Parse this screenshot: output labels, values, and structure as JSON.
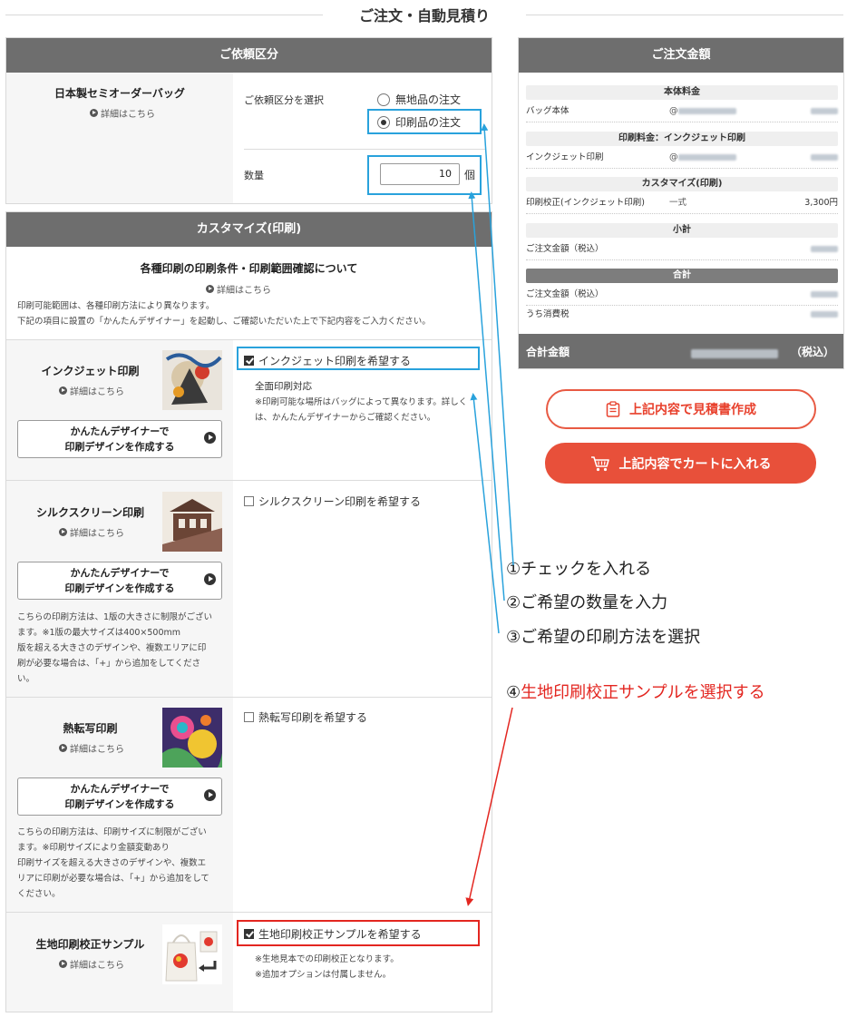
{
  "page": {
    "title": "ご注文・自動見積り"
  },
  "request": {
    "header": "ご依頼区分",
    "product_name": "日本製セミオーダーバッグ",
    "detail_link": "詳細はこちら",
    "select_label": "ご依頼区分を選択",
    "options": [
      "無地品の注文",
      "印刷品の注文"
    ],
    "selected_option": "印刷品の注文",
    "quantity_label": "数量",
    "quantity_value": "10",
    "quantity_unit": "個"
  },
  "customize": {
    "header": "カスタマイズ(印刷)",
    "info_title": "各種印刷の印刷条件・印刷範囲確認について",
    "info_link": "詳細はこちら",
    "info_text_1": "印刷可能範囲は、各種印刷方法により異なります。",
    "info_text_2": "下記の項目に設置の「かんたんデザイナー」を起動し、ご確認いただいた上で下記内容をご入力ください。",
    "methods": [
      {
        "name": "インクジェット印刷",
        "detail_link": "詳細はこちら",
        "designer_btn_1": "かんたんデザイナーで",
        "designer_btn_2": "印刷デザインを作成する",
        "check_label": "インクジェット印刷を希望する",
        "checked": true,
        "note_title": "全面印刷対応",
        "note_1": "※印刷可能な場所はバッグによって異なります。詳しく",
        "note_2": "は、かんたんデザイナーからご確認ください。"
      },
      {
        "name": "シルクスクリーン印刷",
        "detail_link": "詳細はこちら",
        "designer_btn_1": "かんたんデザイナーで",
        "designer_btn_2": "印刷デザインを作成する",
        "check_label": "シルクスクリーン印刷を希望する",
        "checked": false,
        "desc": [
          "こちらの印刷方法は、1版の大きさに制限がござい",
          "ます。※1版の最大サイズは400×500mm",
          "版を超える大きさのデザインや、複数エリアに印",
          "刷が必要な場合は、「+」から追加をしてくださ",
          "い。"
        ]
      },
      {
        "name": "熱転写印刷",
        "detail_link": "詳細はこちら",
        "designer_btn_1": "かんたんデザイナーで",
        "designer_btn_2": "印刷デザインを作成する",
        "check_label": "熱転写印刷を希望する",
        "checked": false,
        "desc": [
          "こちらの印刷方法は、印刷サイズに制限がござい",
          "ます。※印刷サイズにより金額変動あり",
          "印刷サイズを超える大きさのデザインや、複数エ",
          "リアに印刷が必要な場合は、「+」から追加をして",
          "ください。"
        ]
      },
      {
        "name": "生地印刷校正サンプル",
        "detail_link": "詳細はこちら",
        "check_label": "生地印刷校正サンプルを希望する",
        "checked": true,
        "note_1": "※生地見本での印刷校正となります。",
        "note_2": "※追加オプションは付属しません。"
      }
    ]
  },
  "order": {
    "header": "ご注文金額",
    "sections": {
      "body": "本体料金",
      "bag_label": "バッグ本体",
      "at": "@",
      "print": "印刷料金：インクジェット印刷",
      "inkjet_label": "インクジェット印刷",
      "custom": "カスタマイズ(印刷)",
      "proof_label": "印刷校正(インクジェット印刷)",
      "proof_qty": "一式",
      "proof_price": "3,300円",
      "subtotal": "小計",
      "subtotal_label": "ご注文金額（税込）",
      "total": "合計",
      "total_label": "ご注文金額（税込）",
      "tax_label": "うち消費税"
    },
    "total_bar_label": "合計金額",
    "total_tax": "（税込）"
  },
  "actions": {
    "estimate_btn": "上記内容で見積書作成",
    "cart_btn": "上記内容でカートに入れる"
  },
  "annotations": {
    "step1": "①チェックを入れる",
    "step2": "②ご希望の数量を入力",
    "step3": "③ご希望の印刷方法を選択",
    "step4_num": "④",
    "step4_text": "生地印刷校正サンプルを選択する"
  },
  "colors": {
    "accent": "#e8503a",
    "header_grey": "#6e6e6e",
    "highlight_blue": "#29a2dc",
    "highlight_red": "#e32620"
  }
}
